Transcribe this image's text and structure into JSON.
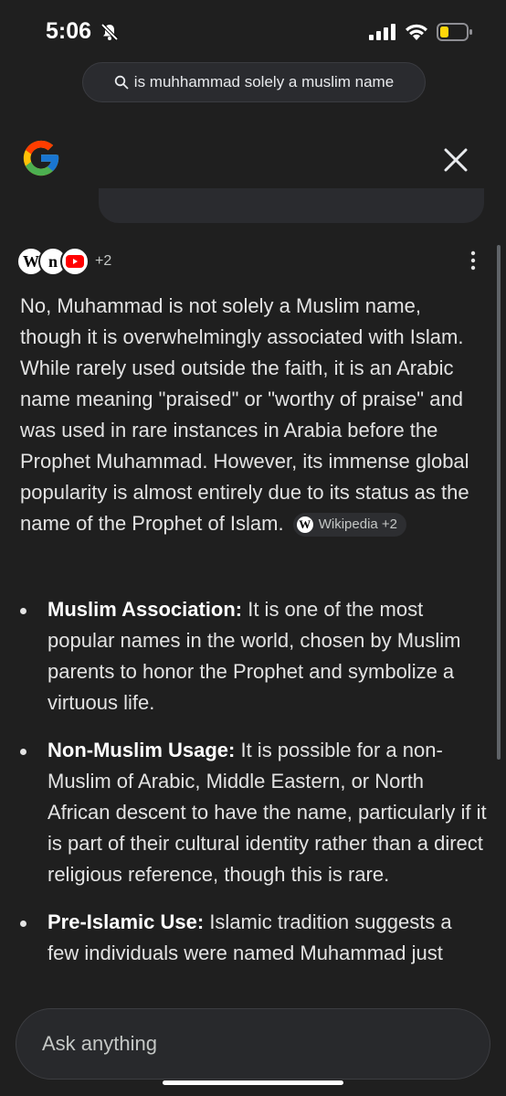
{
  "status": {
    "time": "5:06"
  },
  "search": {
    "query": "is muhhammad solely a muslim name"
  },
  "sources": {
    "more_count": "+2",
    "favicons": [
      "W",
      "n",
      "youtube-icon"
    ]
  },
  "answer": {
    "text": "No, Muhammad is not solely a Muslim name, though it is overwhelmingly associated with Islam. While rarely used outside the faith, it is an Arabic name meaning \"praised\" or \"worthy of praise\" and was used in rare instances in Arabia before the Prophet Muhammad. However, its immense global popularity is almost entirely due to its status as the name of the Prophet of Islam.",
    "chip": "Wikipedia +2",
    "chip_icon": "W"
  },
  "bullets": [
    {
      "title": "Muslim Association:",
      "text": " It is one of the most popular names in the world, chosen by Muslim parents to honor the Prophet and symbolize a virtuous life."
    },
    {
      "title": "Non-Muslim Usage:",
      "text": " It is possible for a non-Muslim of Arabic, Middle Eastern, or North African descent to have the name, particularly if it is part of their cultural identity rather than a direct religious reference, though this is rare."
    },
    {
      "title": "Pre-Islamic Use:",
      "text": " Islamic tradition suggests a few individuals were named Muhammad just"
    }
  ],
  "ask": {
    "placeholder": "Ask anything"
  },
  "colors": {
    "background": "#1f1f1f",
    "text": "#e3e3e3",
    "pill": "#2a2b2f"
  }
}
